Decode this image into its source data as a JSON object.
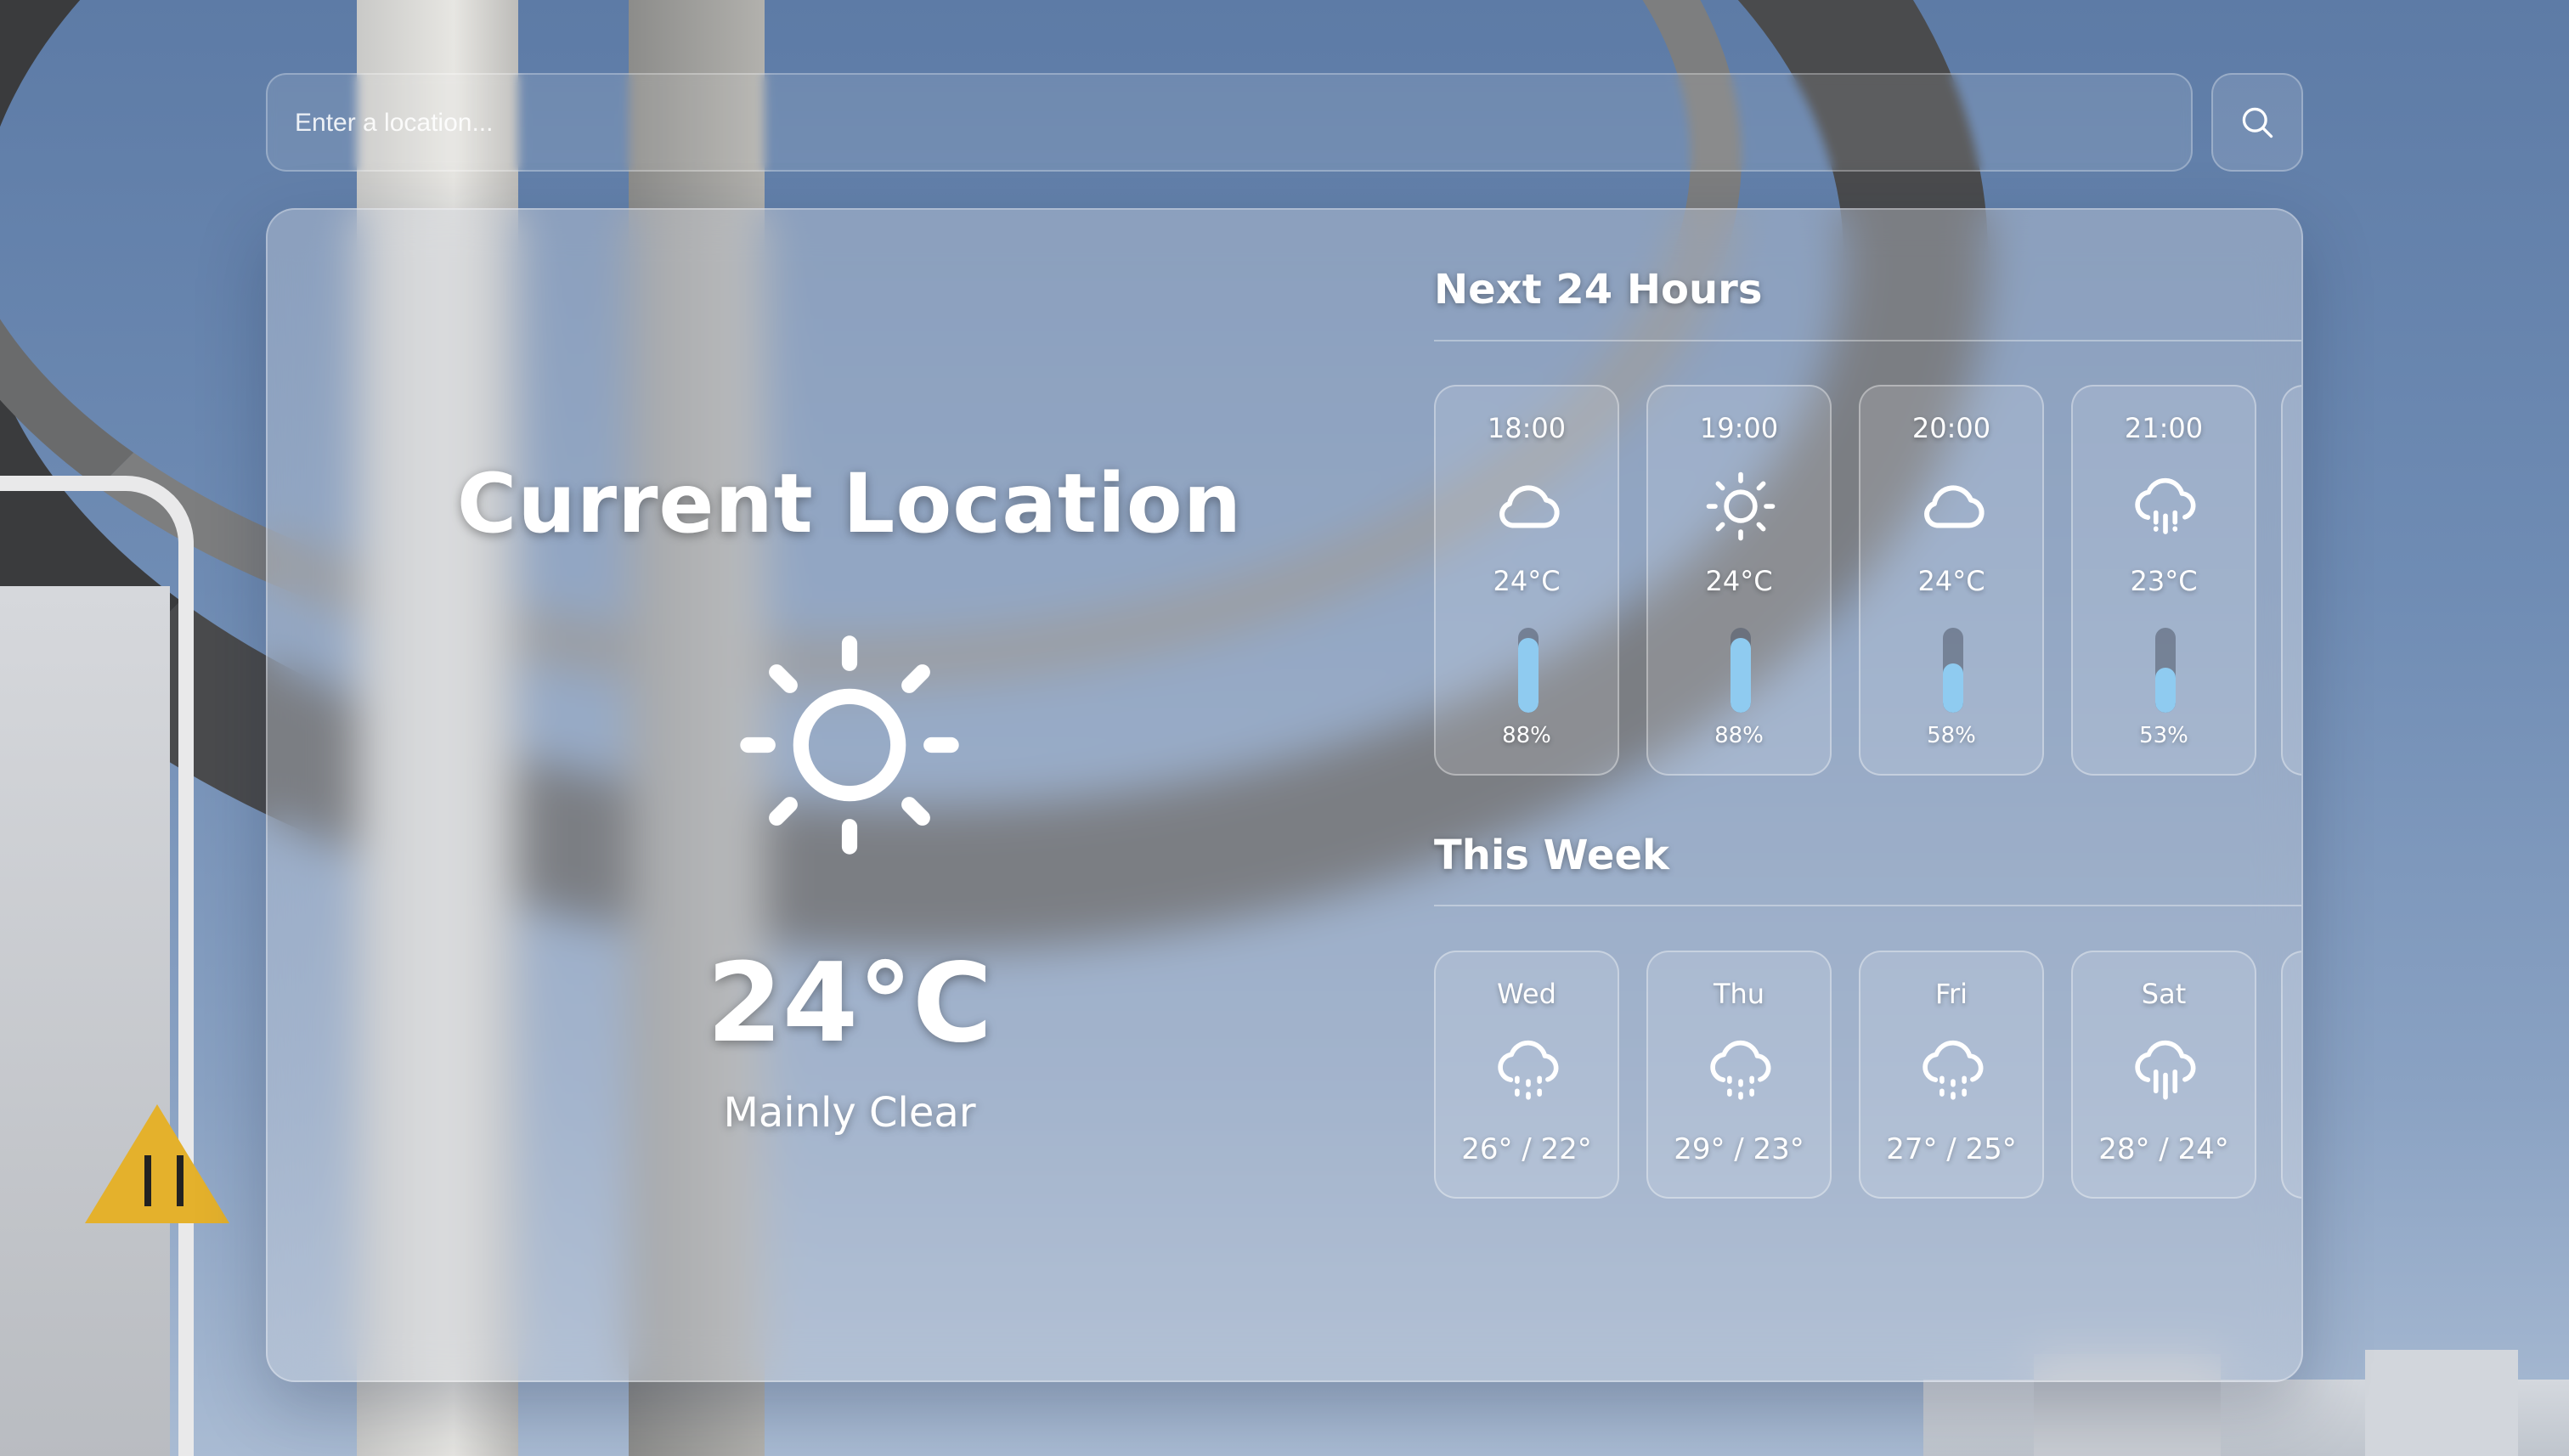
{
  "search": {
    "placeholder": "Enter a location...",
    "button_icon": "search-icon"
  },
  "current": {
    "location": "Current Location",
    "icon": "sun-icon",
    "temperature": "24°C",
    "condition": "Mainly Clear"
  },
  "hourly": {
    "title": "Next 24 Hours",
    "items": [
      {
        "time": "18:00",
        "icon": "cloud-icon",
        "temp": "24°C",
        "humidity": "88%",
        "humidity_value": 88
      },
      {
        "time": "19:00",
        "icon": "sun-icon",
        "temp": "24°C",
        "humidity": "88%",
        "humidity_value": 88
      },
      {
        "time": "20:00",
        "icon": "cloud-icon",
        "temp": "24°C",
        "humidity": "58%",
        "humidity_value": 58
      },
      {
        "time": "21:00",
        "icon": "cloud-rain-icon",
        "temp": "23°C",
        "humidity": "53%",
        "humidity_value": 53
      }
    ]
  },
  "weekly": {
    "title": "This Week",
    "items": [
      {
        "day": "Wed",
        "icon": "cloud-drizzle-icon",
        "range": "26° / 22°"
      },
      {
        "day": "Thu",
        "icon": "cloud-drizzle-icon",
        "range": "29° / 23°"
      },
      {
        "day": "Fri",
        "icon": "cloud-drizzle-icon",
        "range": "27° / 25°"
      },
      {
        "day": "Sat",
        "icon": "cloud-rain-icon",
        "range": "28° / 24°"
      }
    ]
  },
  "colors": {
    "humidity_fill": "#8fcbf0",
    "humidity_track": "#505a69"
  }
}
